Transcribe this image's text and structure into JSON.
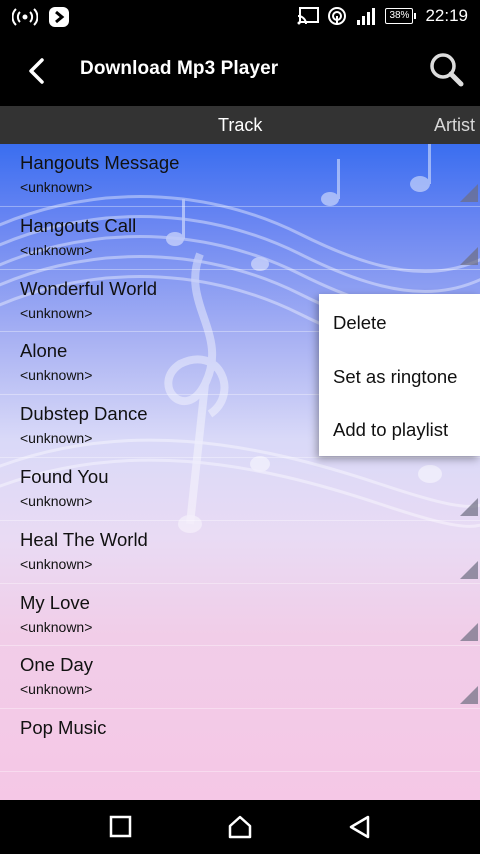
{
  "status_bar": {
    "time": "22:19",
    "battery": "38%"
  },
  "app_bar": {
    "title": "Download Mp3 Player"
  },
  "tabs": [
    {
      "label": "Track"
    },
    {
      "label": "Artist"
    }
  ],
  "tracks": [
    {
      "title": "Hangouts Message",
      "artist": "<unknown>"
    },
    {
      "title": "Hangouts Call",
      "artist": "<unknown>"
    },
    {
      "title": "Wonderful World",
      "artist": "<unknown>"
    },
    {
      "title": "Alone",
      "artist": "<unknown>"
    },
    {
      "title": "Dubstep Dance",
      "artist": "<unknown>"
    },
    {
      "title": "Found You",
      "artist": "<unknown>"
    },
    {
      "title": "Heal The World",
      "artist": "<unknown>"
    },
    {
      "title": "My Love",
      "artist": "<unknown>"
    },
    {
      "title": "One Day",
      "artist": "<unknown>"
    },
    {
      "title": "Pop Music",
      "artist": ""
    }
  ],
  "popup_menu": {
    "items": [
      {
        "label": "Delete"
      },
      {
        "label": "Set as ringtone"
      },
      {
        "label": "Add to playlist"
      }
    ]
  },
  "icons": {
    "back": "arrow-back-icon",
    "search": "search-icon",
    "nav_recent": "recent-apps-icon",
    "nav_home": "home-icon",
    "nav_back": "nav-back-icon"
  }
}
